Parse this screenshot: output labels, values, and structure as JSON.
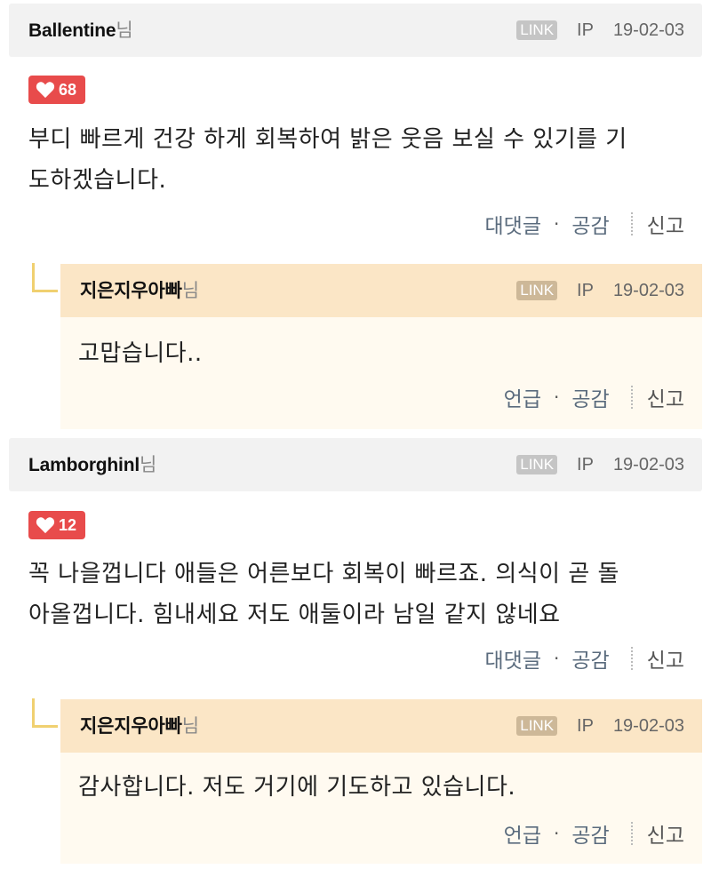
{
  "comments": [
    {
      "author": "Ballentine",
      "suffix": "님",
      "link": "LINK",
      "ip": "IP",
      "date": "19-02-03",
      "likes": "68",
      "text_line1": "부디 빠르게 건강 하게 회복하여 밝은 웃음 보실 수 있기를 기",
      "text_line2": "도하겠습니다.",
      "actions": {
        "reply": "대댓글",
        "empathy": "공감",
        "report": "신고"
      },
      "reply": {
        "author": "지은지우아빠",
        "suffix": "님",
        "link": "LINK",
        "ip": "IP",
        "date": "19-02-03",
        "text": "고맙습니다..",
        "actions": {
          "mention": "언급",
          "empathy": "공감",
          "report": "신고"
        }
      }
    },
    {
      "author": "Lamborghinl",
      "suffix": "님",
      "link": "LINK",
      "ip": "IP",
      "date": "19-02-03",
      "likes": "12",
      "text_line1": "꼭 나을껍니다 애들은 어른보다 회복이 빠르죠. 의식이 곧 돌",
      "text_line2": "아올껍니다. 힘내세요 저도 애둘이라 남일 같지 않네요",
      "actions": {
        "reply": "대댓글",
        "empathy": "공감",
        "report": "신고"
      },
      "reply": {
        "author": "지은지우아빠",
        "suffix": "님",
        "link": "LINK",
        "ip": "IP",
        "date": "19-02-03",
        "text": "감사합니다. 저도 거기에 기도하고 있습니다.",
        "actions": {
          "mention": "언급",
          "empathy": "공감",
          "report": "신고"
        }
      }
    }
  ],
  "colors": {
    "like_badge": "#e84b4b",
    "reply_header": "#fbe6c6",
    "reply_body": "#fffaf0",
    "header_bg": "#f2f2f2"
  },
  "icons": {
    "like": "heart-icon"
  }
}
